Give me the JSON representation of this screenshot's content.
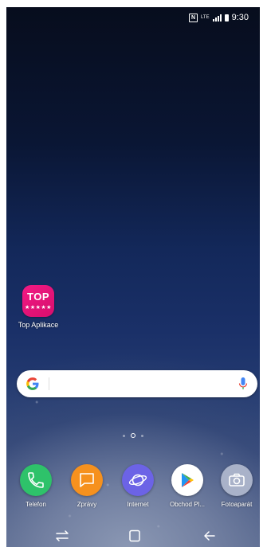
{
  "status_bar": {
    "nfc_icon": "N",
    "network_type": "LTE",
    "time": "9:30"
  },
  "home_screen": {
    "apps": [
      {
        "name": "top-aplikace",
        "icon": "top-icon",
        "icon_text": "TOP",
        "icon_stars": "★★★★★",
        "label": "Top Aplikace",
        "color": "#e8157a"
      }
    ]
  },
  "search_bar": {
    "icon": "google-g-icon",
    "mic_icon": "mic-icon"
  },
  "page_indicator": {
    "pages": 3,
    "current": 2
  },
  "dock": {
    "apps": [
      {
        "label": "Telefon",
        "icon": "phone-icon",
        "color": "#2ec26a"
      },
      {
        "label": "Zprávy",
        "icon": "message-icon",
        "color": "#f6911e"
      },
      {
        "label": "Internet",
        "icon": "internet-icon",
        "color": "#6c63e6"
      },
      {
        "label": "Obchod Pl...",
        "icon": "play-store-icon",
        "color": "#ffffff"
      },
      {
        "label": "Fotoaparát",
        "icon": "camera-icon",
        "color": "#a9b2c9"
      }
    ]
  },
  "nav_bar": {
    "buttons": [
      "recents-icon",
      "home-icon",
      "back-icon"
    ]
  }
}
